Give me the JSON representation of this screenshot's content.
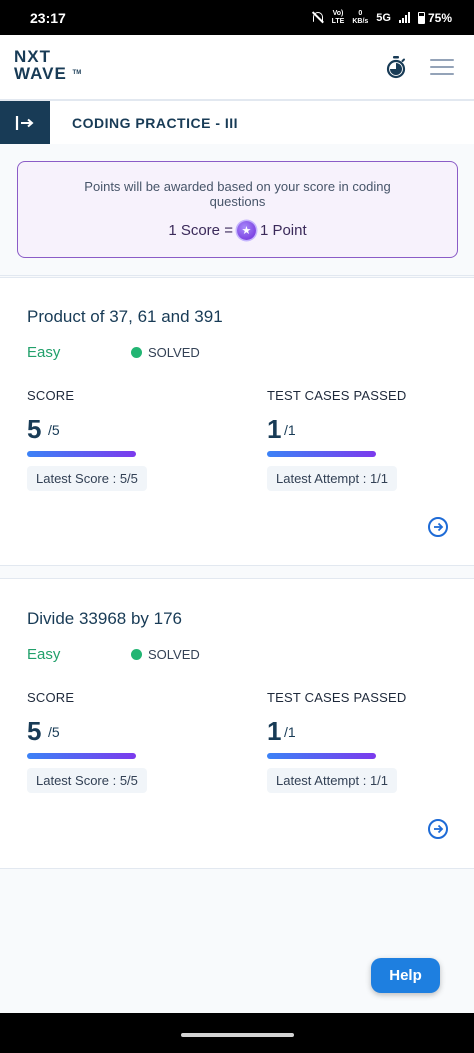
{
  "status_bar": {
    "time": "23:17",
    "volte_top": "Vo)",
    "volte_bottom": "LTE",
    "speed_top": "0",
    "speed_bottom": "KB/s",
    "network": "5G",
    "battery": "75%"
  },
  "header": {
    "logo_line1": "NXT",
    "logo_line2": "WAVE",
    "logo_tm": "TM",
    "icons": [
      "timer-icon",
      "hamburger-menu-icon"
    ]
  },
  "title_bar": {
    "title": "CODING PRACTICE - III",
    "collapse_icon": "collapse-sidebar-icon"
  },
  "info": {
    "text": "Points will be awarded based on your score in coding questions",
    "left": "1 Score =",
    "right": "1 Point",
    "coin_icon": "star-coin-icon"
  },
  "questions": [
    {
      "title": "Product of 37, 61 and 391",
      "difficulty": "Easy",
      "status": "SOLVED",
      "score_label": "SCORE",
      "score": "5",
      "score_total": "/5",
      "score_progress": 1.0,
      "latest_score": "Latest Score : 5/5",
      "tests_label": "TEST CASES PASSED",
      "tests": "1",
      "tests_total": "/1",
      "tests_progress": 1.0,
      "latest_attempt": "Latest Attempt : 1/1"
    },
    {
      "title": "Divide 33968 by 176",
      "difficulty": "Easy",
      "status": "SOLVED",
      "score_label": "SCORE",
      "score": "5",
      "score_total": "/5",
      "score_progress": 1.0,
      "latest_score": "Latest Score : 5/5",
      "tests_label": "TEST CASES PASSED",
      "tests": "1",
      "tests_total": "/1",
      "tests_progress": 1.0,
      "latest_attempt": "Latest Attempt : 1/1"
    }
  ],
  "help_button": "Help",
  "colors": {
    "brand_dark": "#183b56",
    "accent_purple": "#8b5cc7",
    "easy_green": "#22a06b",
    "solved_dot": "#22b573",
    "help_blue": "#1e7fe0"
  }
}
